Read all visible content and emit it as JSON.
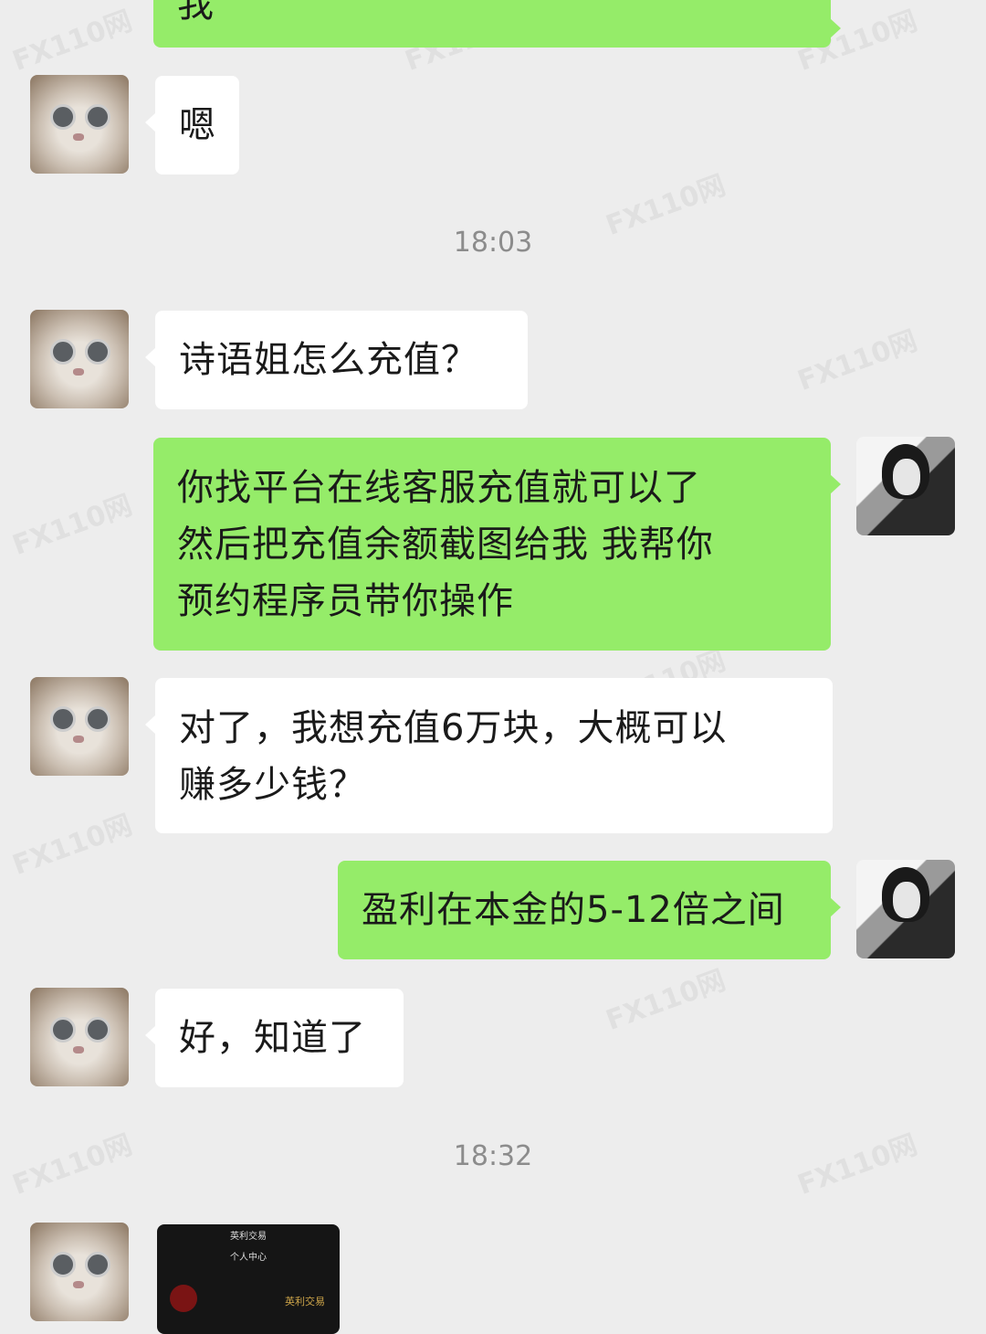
{
  "watermark": "FX110网",
  "timestamps": [
    "18:03",
    "18:32"
  ],
  "messages": [
    {
      "side": "out",
      "lines": [
        "我"
      ]
    },
    {
      "side": "in",
      "lines": [
        "嗯"
      ]
    },
    {
      "side": "in",
      "lines": [
        "诗语姐怎么充值？"
      ]
    },
    {
      "side": "out",
      "lines": [
        "你找平台在线客服充值就可以了",
        "然后把充值余额截图给我  我帮你",
        "预约程序员带你操作"
      ]
    },
    {
      "side": "in",
      "lines": [
        "对了，我想充值6万块，大概可以",
        "赚多少钱？"
      ]
    },
    {
      "side": "out",
      "lines": [
        "盈利在本金的5-12倍之间"
      ]
    },
    {
      "side": "in",
      "lines": [
        "好，知道了"
      ]
    }
  ],
  "image_message": {
    "title": "英利交易",
    "subtitle": "个人中心",
    "brand": "英利交易"
  }
}
